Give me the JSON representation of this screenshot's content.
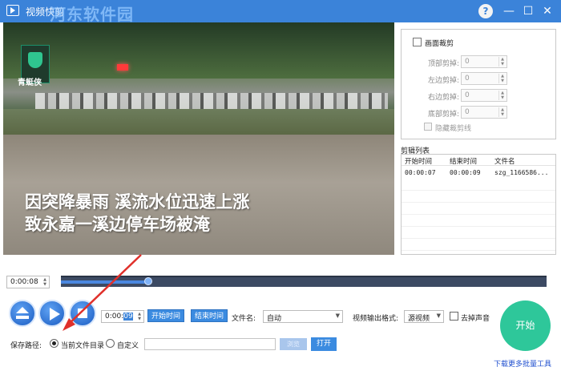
{
  "window": {
    "title": "视频快剪",
    "watermark": "河东软件园",
    "help_label": "?",
    "minimize_label": "—",
    "maximize_label": "☐",
    "close_label": "✕"
  },
  "video": {
    "logo_text": "青蜓侠",
    "caption_line1": "因突降暴雨 溪流水位迅速上涨",
    "caption_line2": "致永嘉一溪边停车场被淹"
  },
  "crop": {
    "title": "画面裁剪",
    "checked": false,
    "fields": [
      {
        "label": "顶部剪掉:",
        "value": "0"
      },
      {
        "label": "左边剪掉:",
        "value": "0"
      },
      {
        "label": "右边剪掉:",
        "value": "0"
      },
      {
        "label": "底部剪掉:",
        "value": "0"
      }
    ],
    "hide_label": "隐藏裁剪线"
  },
  "clip_list": {
    "title": "剪辑列表",
    "columns": [
      "开始时间",
      "结束时间",
      "文件名"
    ],
    "rows": [
      {
        "start": "00:00:07",
        "end": "00:00:09",
        "name": "szg_1166586..."
      }
    ]
  },
  "player": {
    "current_time": "0:00:08",
    "progress_fraction": 0.18,
    "edit_time_prefix": "0:00:",
    "edit_time_selected": "09"
  },
  "controls": {
    "start_time_label": "开始时间",
    "end_time_label": "结束时间",
    "filename_label": "文件名:",
    "filename_value": "自动",
    "format_label": "视频输出格式:",
    "format_value": "源视频",
    "mute_label": "去掉声音",
    "save_path_label": "保存路径:",
    "current_dir_label": "当前文件目录",
    "custom_label": "自定义",
    "browse_label": "浏览",
    "open_label": "打开",
    "start_label": "开始",
    "more_tools_label": "下载更多批量工具"
  },
  "colors": {
    "titlebar": "#3b83d9",
    "accent_button": "#3b8be0",
    "start_button": "#2ec79a",
    "annotation_arrow": "#e0302b"
  }
}
